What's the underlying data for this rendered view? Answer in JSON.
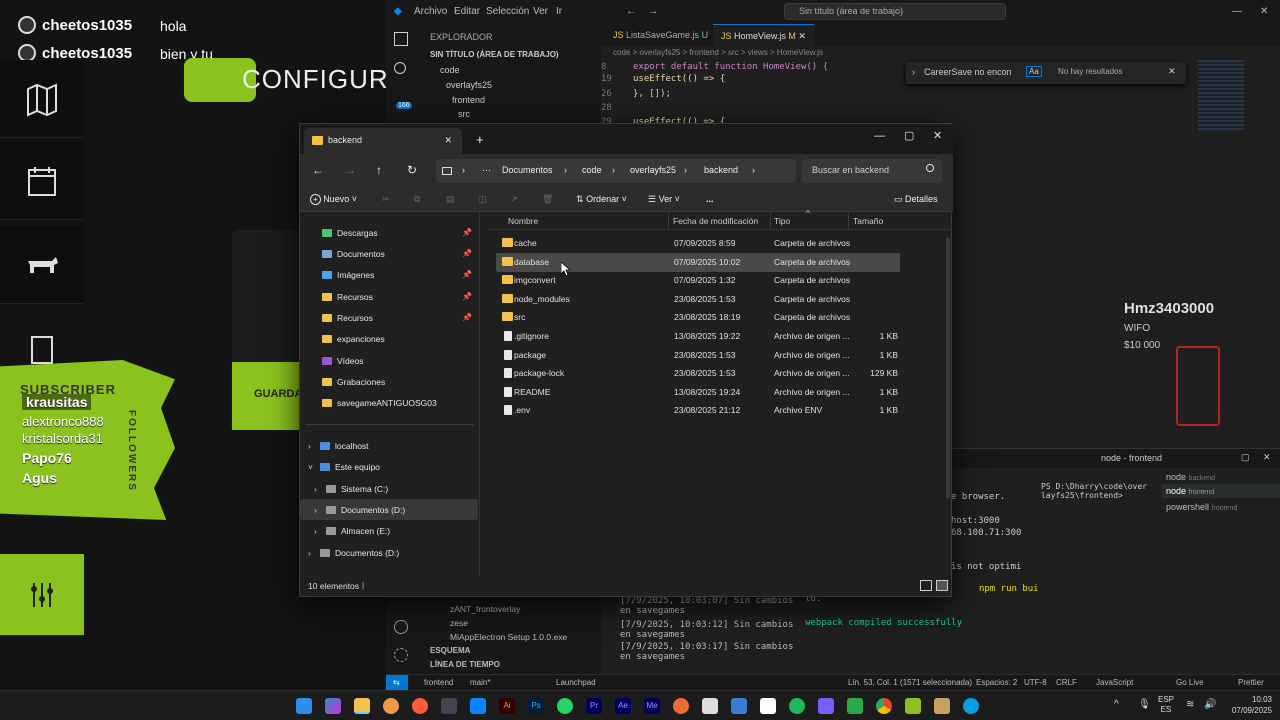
{
  "stream": {
    "chat": [
      {
        "user": "cheetos1035",
        "message": "hola"
      },
      {
        "user": "cheetos1035",
        "message": "bien y tu"
      }
    ],
    "config_title": "CONFIGURA",
    "save_button": "GUARDA",
    "subscriber_label": "SUBSCRIBER",
    "followers_label": "FOLLOWERS",
    "followers": [
      "krausitas",
      "alextronco888",
      "kristalsorda31",
      "Papo76",
      "Agus"
    ],
    "player_name": "Hmz3403000",
    "player_team": "WIFO",
    "player_value": "$10 000"
  },
  "vscode": {
    "menu": [
      "Archivo",
      "Editar",
      "Selección",
      "Ver",
      "Ir"
    ],
    "search_placeholder": "Sin título (área de trabajo)",
    "explorer_title": "EXPLORADOR",
    "workspace": "SIN TÍTULO (ÁREA DE TRABAJO)",
    "tree": [
      "code",
      "overlayfs25",
      "frontend",
      "src"
    ],
    "badge": "166",
    "tabs": [
      {
        "label": "ListaSaveGame.js",
        "status": "U"
      },
      {
        "label": "HomeView.js",
        "status": "M"
      }
    ],
    "breadcrumb": "code > overlayfs25 > frontend > src > views > HomeView.js",
    "code_lines": [
      {
        "n": "8",
        "text": "export default function HomeView() {"
      },
      {
        "n": "19",
        "text": "  useEffect(() => {"
      },
      {
        "n": "26",
        "text": "  }, []);"
      },
      {
        "n": "28",
        "text": ""
      },
      {
        "n": "29",
        "text": "  useEffect(() => {"
      }
    ],
    "find_query": "CareerSave no encon",
    "find_result": "No hay resultados",
    "terminal_title": "node - frontend",
    "terminal_lines": [
      "e browser.",
      "host:3000",
      "68.100.71:300",
      "is not optimi",
      "npm run bui",
      "ld.",
      "webpack compiled successfully"
    ],
    "terminal_prompt": "PS D:\\Dharry\\code\\overlayfs25\\frontend>",
    "terminal_sessions": [
      {
        "name": "node",
        "sub": "backend"
      },
      {
        "name": "node",
        "sub": "frontend"
      },
      {
        "name": "powershell",
        "sub": "frontend"
      }
    ],
    "outline": [
      "zANT_frontoverlay",
      "zese",
      "MiAppElectron Setup 1.0.0.exe",
      "ESQUEMA",
      "LÍNEA DE TIEMPO"
    ],
    "log_lines": [
      "[7/9/2025, 10:03:07] Sin cambios en savegames",
      "[7/9/2025, 10:03:12] Sin cambios en savegames",
      "[7/9/2025, 10:03:17] Sin cambios en savegames"
    ],
    "status": {
      "folder": "frontend",
      "branch": "main*",
      "launchpad": "Launchpad",
      "cursor": "Lín. 53, Col. 1 (1571 seleccionada)",
      "spaces": "Espacios: 2",
      "encoding": "UTF-8",
      "eol": "CRLF",
      "lang": "JavaScript",
      "golive": "Go Live",
      "prettier": "Prettier"
    }
  },
  "explorer": {
    "tab_title": "backend",
    "breadcrumb": [
      "Documentos",
      "code",
      "overlayfs25",
      "backend"
    ],
    "search_placeholder": "Buscar en backend",
    "commands": {
      "new": "Nuevo",
      "sort": "Ordenar",
      "view": "Ver",
      "more": "...",
      "details": "Detalles"
    },
    "nav_quick": [
      {
        "label": "Descargas",
        "icon": "download-icon",
        "pinned": true
      },
      {
        "label": "Documentos",
        "icon": "document-icon",
        "pinned": true
      },
      {
        "label": "Imágenes",
        "icon": "image-icon",
        "pinned": true
      },
      {
        "label": "Recursos",
        "icon": "folder-icon",
        "pinned": true
      },
      {
        "label": "Recursos",
        "icon": "folder-icon",
        "pinned": true
      },
      {
        "label": "expanciones",
        "icon": "folder-icon",
        "pinned": false
      },
      {
        "label": "Vídeos",
        "icon": "video-icon",
        "pinned": false
      },
      {
        "label": "Grabaciones",
        "icon": "folder-icon",
        "pinned": false
      },
      {
        "label": "savegameANTIGUOSG03",
        "icon": "folder-icon",
        "pinned": false
      }
    ],
    "nav_tree": [
      {
        "label": "localhost",
        "level": 0,
        "expanded": false
      },
      {
        "label": "Este equipo",
        "level": 0,
        "expanded": true
      },
      {
        "label": "Sistema (C:)",
        "level": 1,
        "expanded": false
      },
      {
        "label": "Documentos (D:)",
        "level": 1,
        "expanded": false,
        "selected": true
      },
      {
        "label": "Almacen (E:)",
        "level": 1,
        "expanded": false
      },
      {
        "label": "Documentos (D:)",
        "level": 0,
        "expanded": false
      }
    ],
    "columns": [
      "Nombre",
      "Fecha de modificación",
      "Tipo",
      "Tamaño"
    ],
    "files": [
      {
        "name": "cache",
        "date": "07/09/2025 8:59",
        "type": "Carpeta de archivos",
        "size": "",
        "folder": true
      },
      {
        "name": "database",
        "date": "07/09/2025 10:02",
        "type": "Carpeta de archivos",
        "size": "",
        "folder": true
      },
      {
        "name": "imgconvert",
        "date": "07/09/2025 1:32",
        "type": "Carpeta de archivos",
        "size": "",
        "folder": true
      },
      {
        "name": "node_modules",
        "date": "23/08/2025 1:53",
        "type": "Carpeta de archivos",
        "size": "",
        "folder": true
      },
      {
        "name": "src",
        "date": "23/08/2025 18:19",
        "type": "Carpeta de archivos",
        "size": "",
        "folder": true
      },
      {
        "name": ".gitignore",
        "date": "13/08/2025 19:22",
        "type": "Archivo de origen ...",
        "size": "1 KB",
        "folder": false
      },
      {
        "name": "package",
        "date": "23/08/2025 1:53",
        "type": "Archivo de origen ...",
        "size": "1 KB",
        "folder": false
      },
      {
        "name": "package-lock",
        "date": "23/08/2025 1:53",
        "type": "Archivo de origen ...",
        "size": "129 KB",
        "folder": false
      },
      {
        "name": "README",
        "date": "13/08/2025 19:24",
        "type": "Archivo de origen ...",
        "size": "1 KB",
        "folder": false
      },
      {
        "name": ".env",
        "date": "23/08/2025 21:12",
        "type": "Archivo ENV",
        "size": "1 KB",
        "folder": false
      }
    ],
    "item_count": "10 elementos"
  },
  "taskbar": {
    "lang": "ESP",
    "region": "ES",
    "time": "10:03",
    "date": "07/09/2025"
  },
  "colors": {
    "accent": "#8bc21e",
    "vscode_blue": "#0078d4",
    "folder": "#f3c24a"
  }
}
